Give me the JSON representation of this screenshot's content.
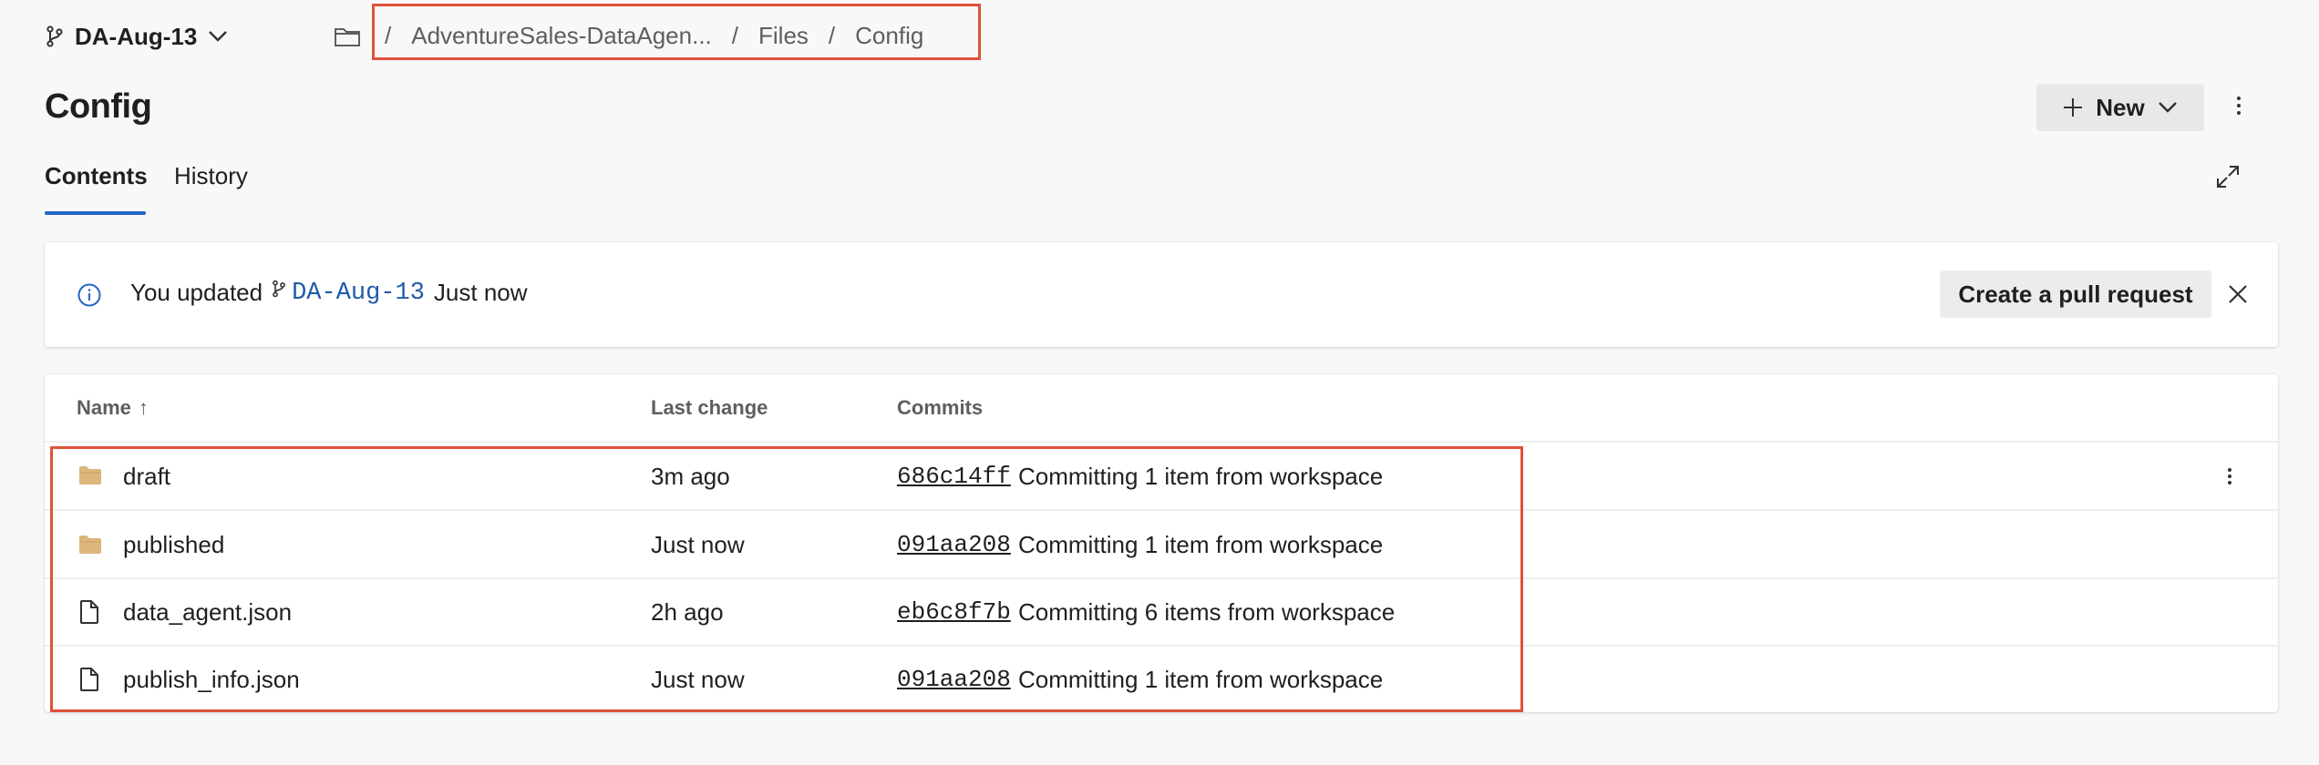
{
  "header": {
    "branch": "DA-Aug-13",
    "breadcrumb": {
      "sep": "/",
      "items": [
        "AdventureSales-DataAgen...",
        "Files",
        "Config"
      ]
    }
  },
  "page": {
    "title": "Config",
    "new_label": "New"
  },
  "tabs": [
    {
      "label": "Contents",
      "active": true
    },
    {
      "label": "History",
      "active": false
    }
  ],
  "banner": {
    "prefix": "You updated",
    "branch": "DA-Aug-13",
    "suffix": "Just now",
    "pr_label": "Create a pull request"
  },
  "table": {
    "headers": {
      "name": "Name",
      "sort": "↑",
      "last_change": "Last change",
      "commits": "Commits"
    },
    "rows": [
      {
        "type": "folder",
        "name": "draft",
        "last_change": "3m ago",
        "commit": "686c14ff",
        "message": "Committing 1 item from workspace"
      },
      {
        "type": "folder",
        "name": "published",
        "last_change": "Just now",
        "commit": "091aa208",
        "message": "Committing 1 item from workspace"
      },
      {
        "type": "file",
        "name": "data_agent.json",
        "last_change": "2h ago",
        "commit": "eb6c8f7b",
        "message": "Committing 6 items from workspace"
      },
      {
        "type": "file",
        "name": "publish_info.json",
        "last_change": "Just now",
        "commit": "091aa208",
        "message": "Committing 1 item from workspace"
      }
    ]
  },
  "colors": {
    "accent": "#2266c6",
    "highlight": "#e0513a",
    "folder": "#dcb67a",
    "link": "#1f5aa6"
  },
  "icons": [
    "branch-icon",
    "chevron-down-icon",
    "folder-outline-icon",
    "plus-icon",
    "more-vertical-icon",
    "expand-icon",
    "info-icon",
    "close-icon",
    "folder-icon",
    "file-icon",
    "sort-ascending-icon"
  ]
}
